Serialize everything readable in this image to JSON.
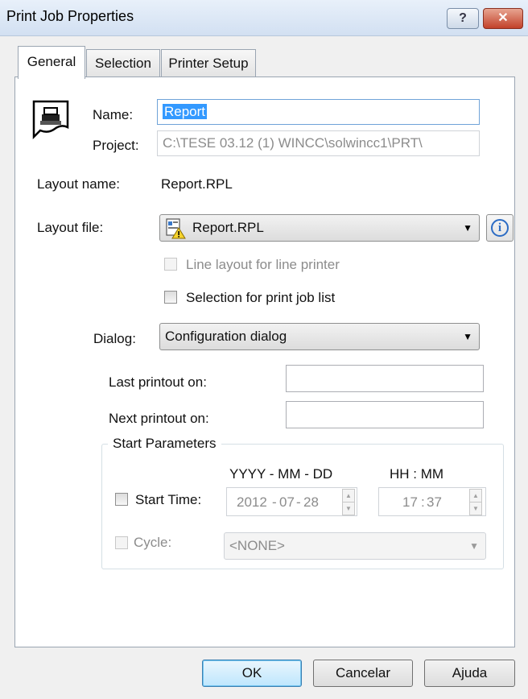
{
  "window": {
    "title": "Print Job Properties",
    "help_glyph": "?",
    "close_glyph": "✕"
  },
  "tabs": [
    {
      "label": "General",
      "active": true
    },
    {
      "label": "Selection",
      "active": false
    },
    {
      "label": "Printer Setup",
      "active": false
    }
  ],
  "general": {
    "name_label": "Name:",
    "name_value": "Report",
    "project_label": "Project:",
    "project_value": "C:\\TESE 03.12 (1) WINCC\\solwincc1\\PRT\\",
    "layout_name_label": "Layout name:",
    "layout_name_value": "Report.RPL",
    "layout_file_label": "Layout file:",
    "layout_file_value": "Report.RPL",
    "info_glyph": "i",
    "line_layout_label": "Line layout for line printer",
    "selection_label": "Selection for print job list",
    "dialog_label": "Dialog:",
    "dialog_value": "Configuration dialog",
    "last_printout_label": "Last printout on:",
    "last_printout_value": "",
    "next_printout_label": "Next printout on:",
    "next_printout_value": ""
  },
  "start_parameters": {
    "title": "Start Parameters",
    "date_header": "YYYY - MM - DD",
    "time_header": "HH : MM",
    "start_time_label": "Start Time:",
    "date": {
      "year": "2012",
      "month": "07",
      "day": "28"
    },
    "time": {
      "hour": "17",
      "minute": "37"
    },
    "separator_dash": "-",
    "separator_colon": ":",
    "cycle_label": "Cycle:",
    "cycle_value": "<NONE>"
  },
  "buttons": {
    "ok": "OK",
    "cancel": "Cancelar",
    "help": "Ajuda"
  },
  "colors": {
    "selection_highlight": "#3399ff",
    "close_button": "#c2412a",
    "title_bar": "#d2e0f2"
  }
}
